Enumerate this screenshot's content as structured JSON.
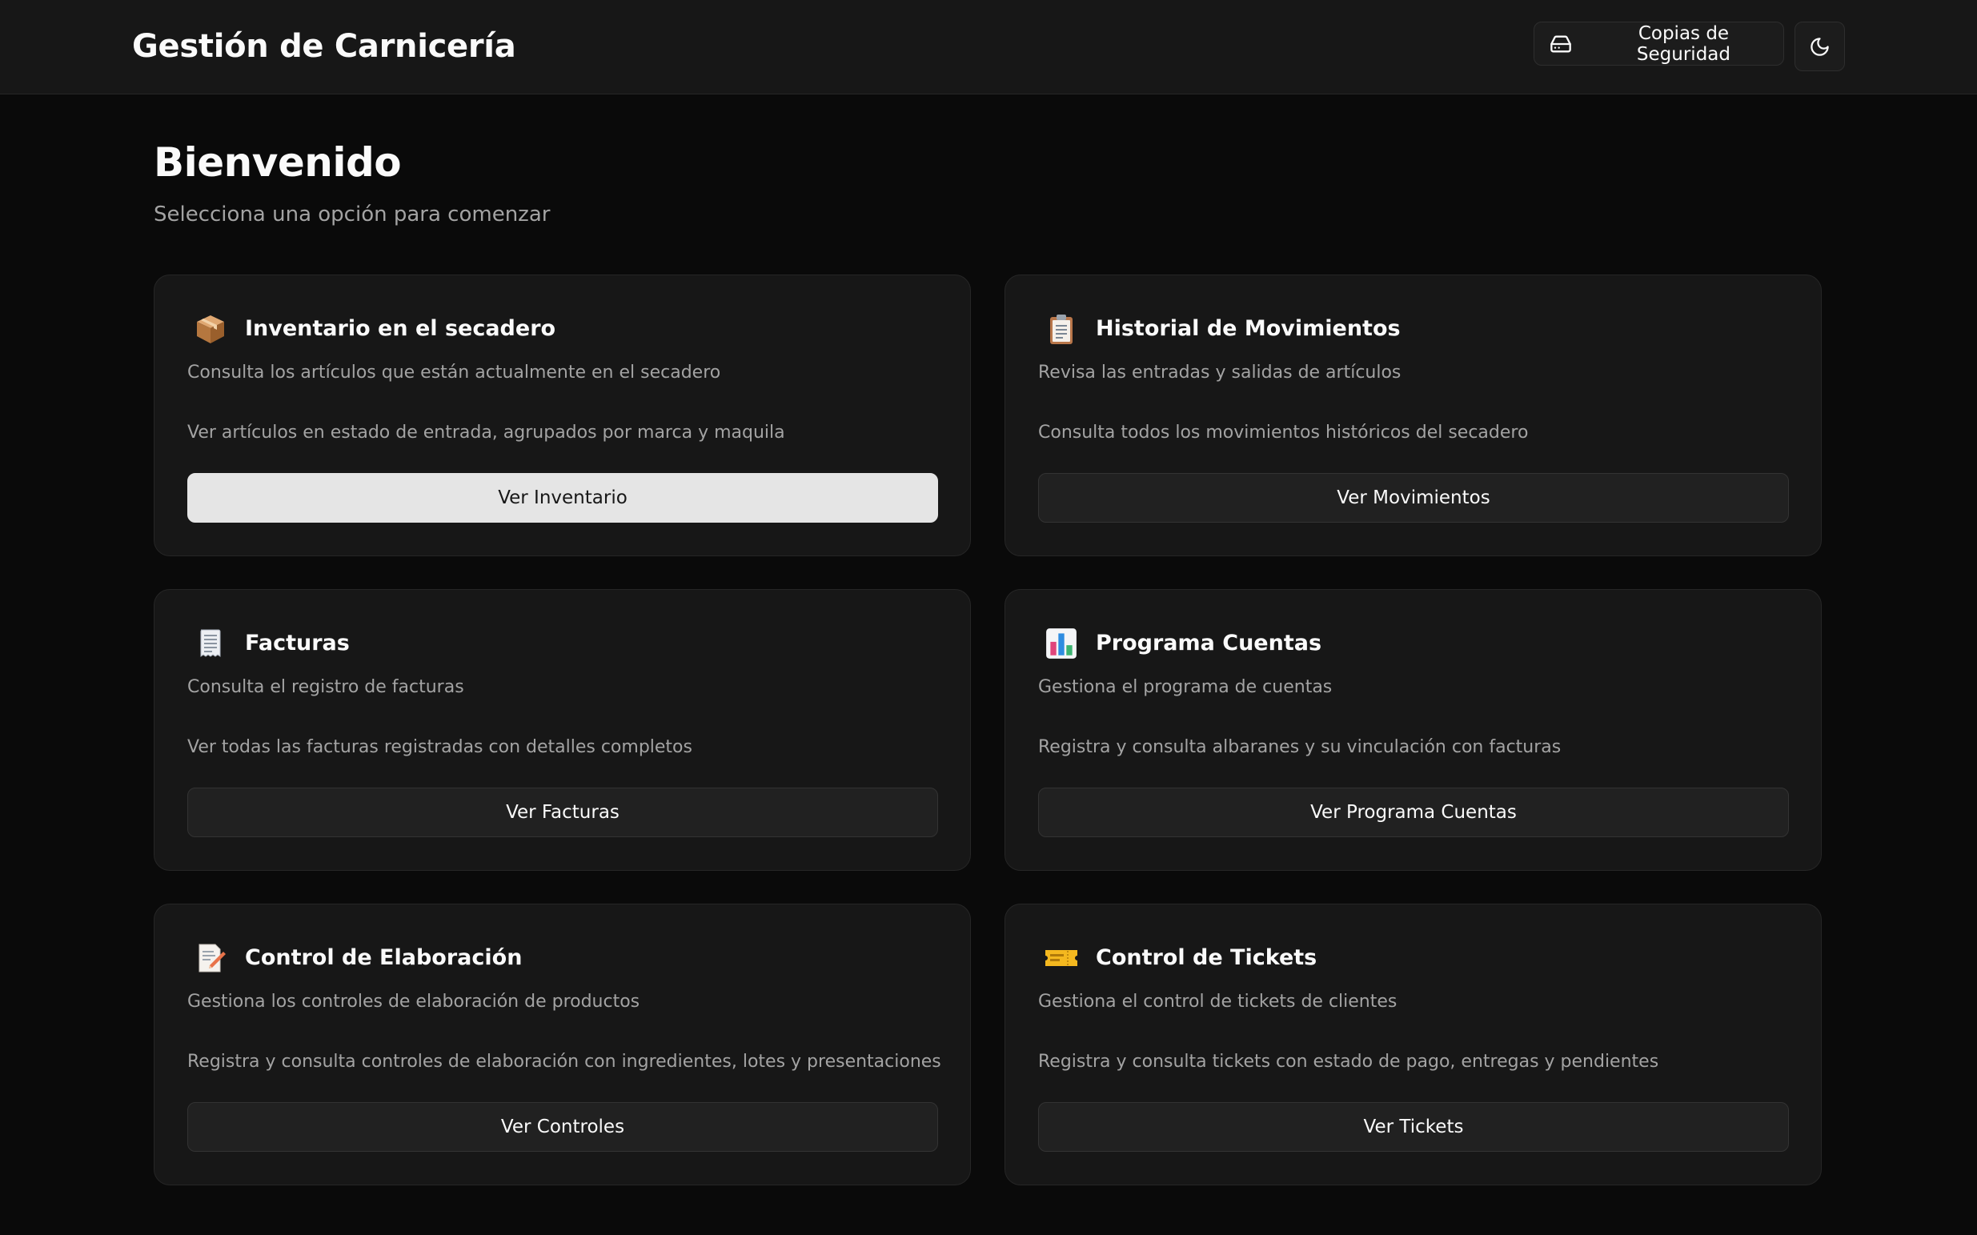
{
  "header": {
    "title": "Gestión de Carnicería",
    "backup_label": "Copias de Seguridad",
    "backup_icon": "hard-drive-icon",
    "theme_icon": "moon-icon"
  },
  "welcome": {
    "title": "Bienvenido",
    "subtitle": "Selecciona una opción para comenzar"
  },
  "cards": [
    {
      "icon": "package-icon",
      "title": "Inventario en el secadero",
      "description": "Consulta los artículos que están actualmente en el secadero",
      "detail": "Ver artículos en estado de entrada, agrupados por marca y maquila",
      "button_label": "Ver Inventario"
    },
    {
      "icon": "clipboard-icon",
      "title": "Historial de Movimientos",
      "description": "Revisa las entradas y salidas de artículos",
      "detail": "Consulta todos los movimientos históricos del secadero",
      "button_label": "Ver Movimientos"
    },
    {
      "icon": "receipt-icon",
      "title": "Facturas",
      "description": "Consulta el registro de facturas",
      "detail": "Ver todas las facturas registradas con detalles completos",
      "button_label": "Ver Facturas"
    },
    {
      "icon": "bar-chart-icon",
      "title": "Programa Cuentas",
      "description": "Gestiona el programa de cuentas",
      "detail": "Registra y consulta albaranes y su vinculación con facturas",
      "button_label": "Ver Programa Cuentas"
    },
    {
      "icon": "memo-icon",
      "title": "Control de Elaboración",
      "description": "Gestiona los controles de elaboración de productos",
      "detail": "Registra y consulta controles de elaboración con ingredientes, lotes y presentaciones",
      "button_label": "Ver Controles"
    },
    {
      "icon": "ticket-icon",
      "title": "Control de Tickets",
      "description": "Gestiona el control de tickets de clientes",
      "detail": "Registra y consulta tickets con estado de pago, entregas y pendientes",
      "button_label": "Ver Tickets"
    }
  ]
}
